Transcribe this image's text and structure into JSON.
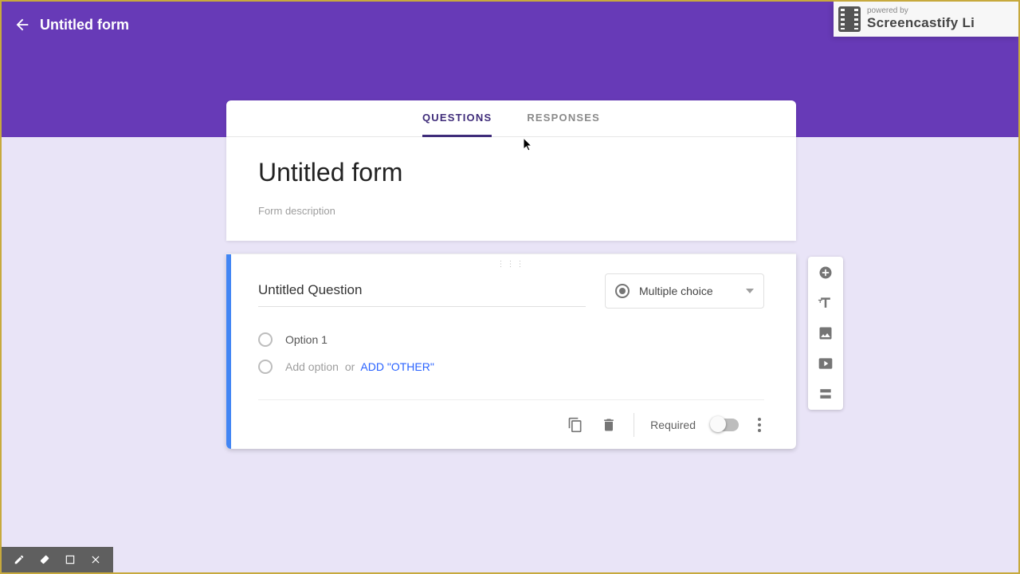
{
  "header": {
    "title": "Untitled form"
  },
  "overlay": {
    "powered_by": "powered by",
    "brand": "Screencastify Li"
  },
  "tabs": {
    "questions": "QUESTIONS",
    "responses": "RESPONSES"
  },
  "form": {
    "title": "Untitled form",
    "description_placeholder": "Form description"
  },
  "question": {
    "title": "Untitled Question",
    "type_label": "Multiple choice",
    "options": [
      {
        "label": "Option 1"
      }
    ],
    "add_option": "Add option",
    "or": "or",
    "add_other": "ADD \"OTHER\"",
    "required_label": "Required"
  }
}
